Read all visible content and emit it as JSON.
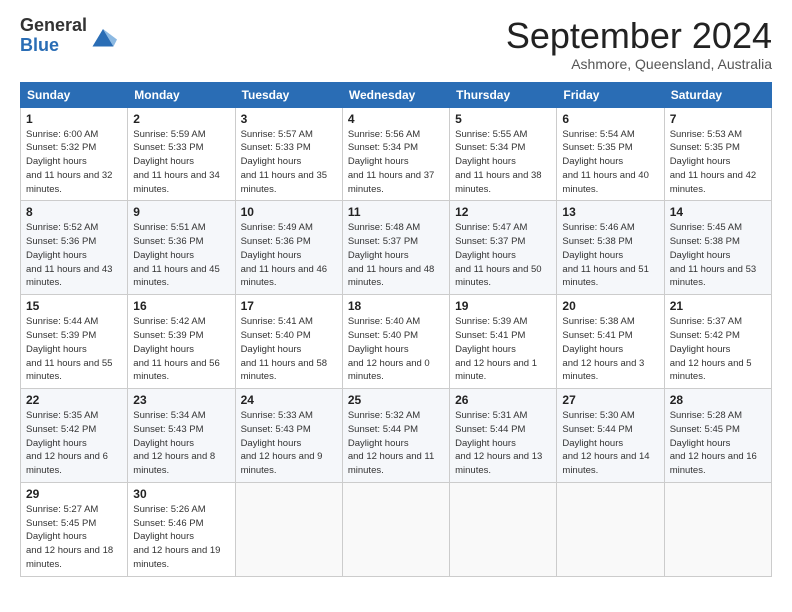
{
  "logo": {
    "line1": "General",
    "line2": "Blue"
  },
  "title": "September 2024",
  "subtitle": "Ashmore, Queensland, Australia",
  "weekdays": [
    "Sunday",
    "Monday",
    "Tuesday",
    "Wednesday",
    "Thursday",
    "Friday",
    "Saturday"
  ],
  "weeks": [
    [
      {
        "day": "1",
        "rise": "6:00 AM",
        "set": "5:32 PM",
        "hours": "11 hours and 32 minutes."
      },
      {
        "day": "2",
        "rise": "5:59 AM",
        "set": "5:33 PM",
        "hours": "11 hours and 34 minutes."
      },
      {
        "day": "3",
        "rise": "5:57 AM",
        "set": "5:33 PM",
        "hours": "11 hours and 35 minutes."
      },
      {
        "day": "4",
        "rise": "5:56 AM",
        "set": "5:34 PM",
        "hours": "11 hours and 37 minutes."
      },
      {
        "day": "5",
        "rise": "5:55 AM",
        "set": "5:34 PM",
        "hours": "11 hours and 38 minutes."
      },
      {
        "day": "6",
        "rise": "5:54 AM",
        "set": "5:35 PM",
        "hours": "11 hours and 40 minutes."
      },
      {
        "day": "7",
        "rise": "5:53 AM",
        "set": "5:35 PM",
        "hours": "11 hours and 42 minutes."
      }
    ],
    [
      {
        "day": "8",
        "rise": "5:52 AM",
        "set": "5:36 PM",
        "hours": "11 hours and 43 minutes."
      },
      {
        "day": "9",
        "rise": "5:51 AM",
        "set": "5:36 PM",
        "hours": "11 hours and 45 minutes."
      },
      {
        "day": "10",
        "rise": "5:49 AM",
        "set": "5:36 PM",
        "hours": "11 hours and 46 minutes."
      },
      {
        "day": "11",
        "rise": "5:48 AM",
        "set": "5:37 PM",
        "hours": "11 hours and 48 minutes."
      },
      {
        "day": "12",
        "rise": "5:47 AM",
        "set": "5:37 PM",
        "hours": "11 hours and 50 minutes."
      },
      {
        "day": "13",
        "rise": "5:46 AM",
        "set": "5:38 PM",
        "hours": "11 hours and 51 minutes."
      },
      {
        "day": "14",
        "rise": "5:45 AM",
        "set": "5:38 PM",
        "hours": "11 hours and 53 minutes."
      }
    ],
    [
      {
        "day": "15",
        "rise": "5:44 AM",
        "set": "5:39 PM",
        "hours": "11 hours and 55 minutes."
      },
      {
        "day": "16",
        "rise": "5:42 AM",
        "set": "5:39 PM",
        "hours": "11 hours and 56 minutes."
      },
      {
        "day": "17",
        "rise": "5:41 AM",
        "set": "5:40 PM",
        "hours": "11 hours and 58 minutes."
      },
      {
        "day": "18",
        "rise": "5:40 AM",
        "set": "5:40 PM",
        "hours": "12 hours and 0 minutes."
      },
      {
        "day": "19",
        "rise": "5:39 AM",
        "set": "5:41 PM",
        "hours": "12 hours and 1 minute."
      },
      {
        "day": "20",
        "rise": "5:38 AM",
        "set": "5:41 PM",
        "hours": "12 hours and 3 minutes."
      },
      {
        "day": "21",
        "rise": "5:37 AM",
        "set": "5:42 PM",
        "hours": "12 hours and 5 minutes."
      }
    ],
    [
      {
        "day": "22",
        "rise": "5:35 AM",
        "set": "5:42 PM",
        "hours": "12 hours and 6 minutes."
      },
      {
        "day": "23",
        "rise": "5:34 AM",
        "set": "5:43 PM",
        "hours": "12 hours and 8 minutes."
      },
      {
        "day": "24",
        "rise": "5:33 AM",
        "set": "5:43 PM",
        "hours": "12 hours and 9 minutes."
      },
      {
        "day": "25",
        "rise": "5:32 AM",
        "set": "5:44 PM",
        "hours": "12 hours and 11 minutes."
      },
      {
        "day": "26",
        "rise": "5:31 AM",
        "set": "5:44 PM",
        "hours": "12 hours and 13 minutes."
      },
      {
        "day": "27",
        "rise": "5:30 AM",
        "set": "5:44 PM",
        "hours": "12 hours and 14 minutes."
      },
      {
        "day": "28",
        "rise": "5:28 AM",
        "set": "5:45 PM",
        "hours": "12 hours and 16 minutes."
      }
    ],
    [
      {
        "day": "29",
        "rise": "5:27 AM",
        "set": "5:45 PM",
        "hours": "12 hours and 18 minutes."
      },
      {
        "day": "30",
        "rise": "5:26 AM",
        "set": "5:46 PM",
        "hours": "12 hours and 19 minutes."
      },
      null,
      null,
      null,
      null,
      null
    ]
  ]
}
